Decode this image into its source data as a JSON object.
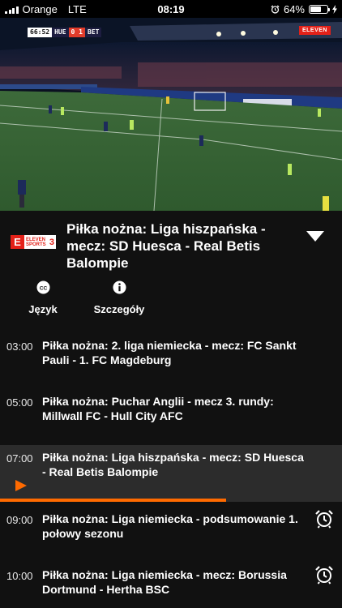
{
  "status_bar": {
    "carrier": "Orange",
    "network": "LTE",
    "time": "08:19",
    "battery": "64%",
    "battery_level": 0.64
  },
  "video": {
    "scoreboard": {
      "clock": "66:52",
      "home": "HUE",
      "score": "0  1",
      "away": "BET"
    },
    "channel_logo": "ELEVEN"
  },
  "program": {
    "channel": {
      "name_line1": "ELEVEN",
      "name_line2": "SPORTS",
      "number": "3"
    },
    "title": "Piłka nożna: Liga hiszpańska - mecz: SD Huesca - Real Betis Balompie",
    "actions": {
      "language": "Język",
      "details": "Szczegóły"
    }
  },
  "schedule": {
    "items": [
      {
        "time": "03:00",
        "title": "Piłka nożna: 2. liga niemiecka - mecz: FC Sankt Pauli - 1. FC Magdeburg"
      },
      {
        "time": "05:00",
        "title": "Piłka nożna: Puchar Anglii - mecz 3. rundy: Millwall FC - Hull City AFC"
      },
      {
        "time": "07:00",
        "title": "Piłka nożna: Liga hiszpańska - mecz: SD Huesca - Real Betis Balompie"
      },
      {
        "time": "09:00",
        "title": "Piłka nożna: Liga niemiecka - podsumowanie 1. połowy sezonu"
      },
      {
        "time": "10:00",
        "title": "Piłka nożna: Liga niemiecka - mecz: Borussia Dortmund - Hertha BSC"
      }
    ],
    "active_progress": 0.66
  },
  "colors": {
    "accent": "#ff6a00",
    "brand_red": "#e32119",
    "background": "#111111",
    "active_row": "#2c2c2c"
  },
  "icons": [
    "signal-icon",
    "alarm-clock-status-icon",
    "battery-icon",
    "charging-icon",
    "chevron-down-icon",
    "closed-caption-icon",
    "info-icon",
    "play-icon",
    "alarm-icon"
  ]
}
